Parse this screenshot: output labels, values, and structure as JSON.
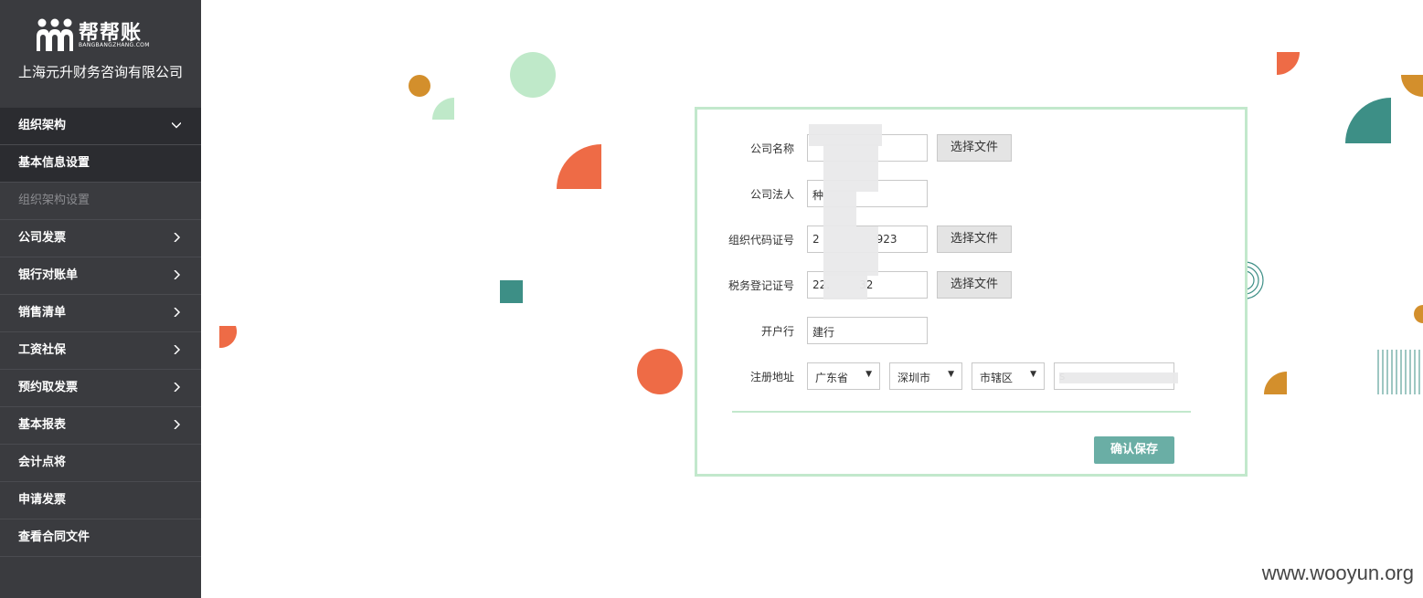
{
  "brand": {
    "logo_text": "帮帮账",
    "logo_sub": "BANGBANGZHANG.COM",
    "company_name": "上海元升财务咨询有限公司"
  },
  "sidebar": {
    "items": [
      {
        "label": "组织架构",
        "chevron": "chevron-down"
      },
      {
        "label": "基本信息设置",
        "chevron": ""
      },
      {
        "label": "组织架构设置",
        "chevron": ""
      },
      {
        "label": "公司发票",
        "chevron": "chevron-right"
      },
      {
        "label": "银行对账单",
        "chevron": "chevron-right"
      },
      {
        "label": "销售清单",
        "chevron": "chevron-right"
      },
      {
        "label": "工资社保",
        "chevron": "chevron-right"
      },
      {
        "label": "预约取发票",
        "chevron": "chevron-right"
      },
      {
        "label": "基本报表",
        "chevron": "chevron-right"
      },
      {
        "label": "会计点将",
        "chevron": ""
      },
      {
        "label": "申请发票",
        "chevron": ""
      },
      {
        "label": "查看合同文件",
        "chevron": ""
      }
    ]
  },
  "form": {
    "company_name": {
      "label": "公司名称",
      "value": "",
      "button": "选择文件"
    },
    "legal_person": {
      "label": "公司法人",
      "value": "种"
    },
    "org_code": {
      "label": "组织代码证号",
      "value_prefix": "2",
      "value_suffix": "923",
      "button": "选择文件"
    },
    "tax_reg": {
      "label": "税务登记证号",
      "value_prefix": "22.",
      "value_suffix": "32",
      "button": "选择文件"
    },
    "bank": {
      "label": "开户行",
      "value": "建行"
    },
    "address": {
      "label": "注册地址",
      "province": "广东省",
      "city": "深圳市",
      "district": "市辖区",
      "detail": "s"
    },
    "save_button": "确认保存"
  },
  "watermark": "www.wooyun.org",
  "colors": {
    "sidebar_bg": "#3a3b3f",
    "sidebar_active": "#2b2c30",
    "card_border": "#c2e8cc",
    "save_button": "#6aaea5",
    "deco_orange": "#ee6b46",
    "deco_gold": "#d38f2c",
    "deco_teal": "#3d8f86",
    "deco_mint": "#bfe9c9"
  }
}
